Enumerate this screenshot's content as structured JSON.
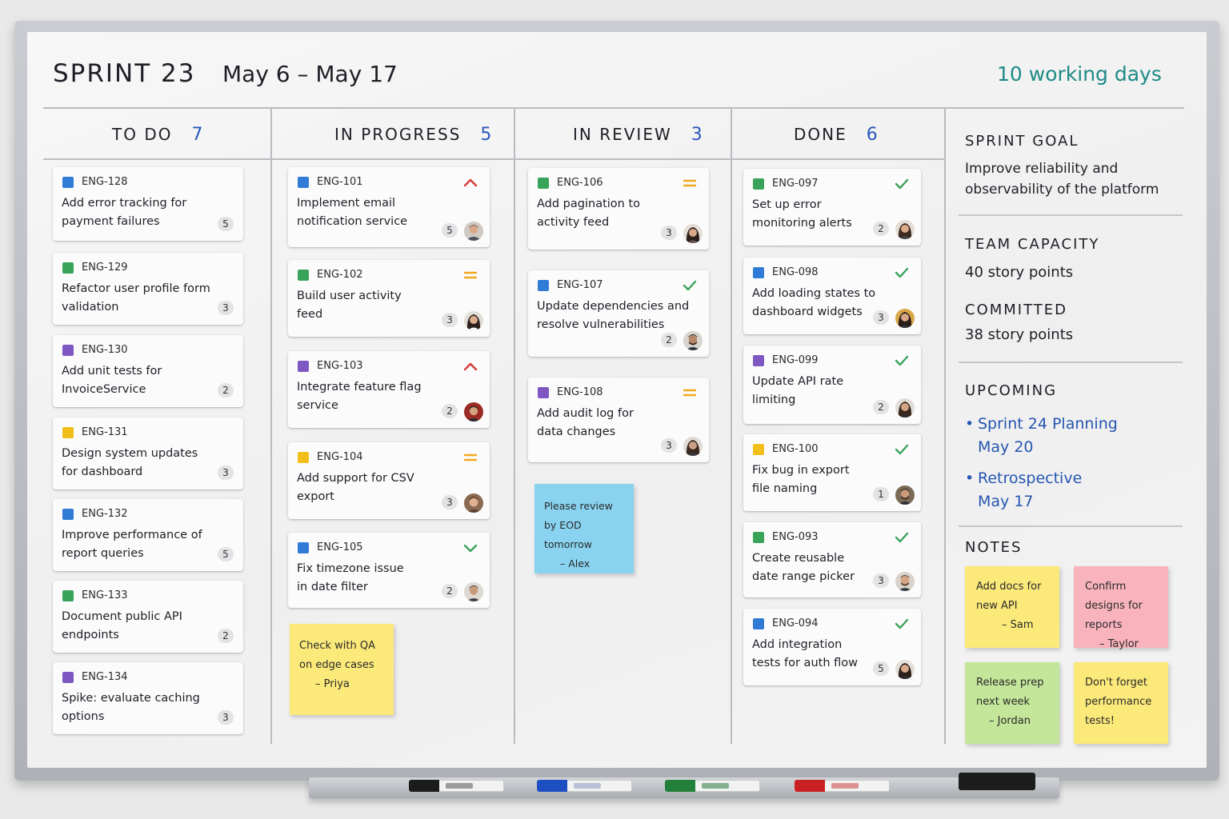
{
  "header": {
    "title": "SPRINT 23",
    "dates": "May 6 – May 17",
    "working_days": "10 working days"
  },
  "columns": [
    {
      "label": "TO DO",
      "count": "7"
    },
    {
      "label": "IN PROGRESS",
      "count": "5"
    },
    {
      "label": "IN REVIEW",
      "count": "3"
    },
    {
      "label": "DONE",
      "count": "6"
    }
  ],
  "todo": [
    {
      "key": "ENG-128",
      "title": "Add error tracking for payment failures",
      "points": "5",
      "color": "#2f7bd6"
    },
    {
      "key": "ENG-129",
      "title": "Refactor user profile form validation",
      "points": "3",
      "color": "#3aa35a"
    },
    {
      "key": "ENG-130",
      "title": "Add unit tests for InvoiceService",
      "points": "2",
      "color": "#7e57c2"
    },
    {
      "key": "ENG-131",
      "title": "Design system updates for dashboard",
      "points": "3",
      "color": "#f2be1a"
    },
    {
      "key": "ENG-132",
      "title": "Improve performance of report queries",
      "points": "5",
      "color": "#2f7bd6"
    },
    {
      "key": "ENG-133",
      "title": "Document public API endpoints",
      "points": "2",
      "color": "#3aa35a"
    },
    {
      "key": "ENG-134",
      "title": "Spike: evaluate caching options",
      "points": "3",
      "color": "#7e57c2"
    }
  ],
  "in_progress": [
    {
      "key": "ENG-101",
      "title": "Implement email notification service",
      "points": "5",
      "color": "#2f7bd6",
      "priority": "high-priority-icon"
    },
    {
      "key": "ENG-102",
      "title": "Build user activity feed",
      "points": "3",
      "color": "#3aa35a",
      "priority": "medium-priority-icon"
    },
    {
      "key": "ENG-103",
      "title": "Integrate feature flag service",
      "points": "2",
      "color": "#7e57c2",
      "priority": "high-priority-icon"
    },
    {
      "key": "ENG-104",
      "title": "Add support for CSV export",
      "points": "3",
      "color": "#f2be1a",
      "priority": "medium-priority-icon"
    },
    {
      "key": "ENG-105",
      "title": "Fix timezone issue in date filter",
      "points": "2",
      "color": "#2f7bd6",
      "priority": "low-priority-icon"
    }
  ],
  "in_review": [
    {
      "key": "ENG-106",
      "title": "Add pagination to activity feed",
      "points": "3",
      "color": "#3aa35a",
      "priority": "medium-priority-icon"
    },
    {
      "key": "ENG-107",
      "title": "Update dependencies and resolve vulnerabilities",
      "points": "2",
      "color": "#2f7bd6",
      "priority": "low-priority-icon"
    },
    {
      "key": "ENG-108",
      "title": "Add audit log for data changes",
      "points": "3",
      "color": "#7e57c2",
      "priority": "medium-priority-icon"
    }
  ],
  "done": [
    {
      "key": "ENG-097",
      "title": "Set up error monitoring alerts",
      "points": "2",
      "color": "#3aa35a"
    },
    {
      "key": "ENG-098",
      "title": "Add loading states to dashboard widgets",
      "points": "3",
      "color": "#2f7bd6"
    },
    {
      "key": "ENG-099",
      "title": "Update API rate limiting",
      "points": "2",
      "color": "#7e57c2"
    },
    {
      "key": "ENG-100",
      "title": "Fix bug in export file naming",
      "points": "1",
      "color": "#f2be1a"
    },
    {
      "key": "ENG-093",
      "title": "Create reusable date range picker",
      "points": "3",
      "color": "#3aa35a"
    },
    {
      "key": "ENG-094",
      "title": "Add integration tests for auth flow",
      "points": "5",
      "color": "#2f7bd6"
    }
  ],
  "stickies": {
    "qa": {
      "text": "Check with QA on edge cases",
      "author": "– Priya"
    },
    "review": {
      "text": "Please review by EOD tomorrow",
      "author": "– Alex"
    }
  },
  "sidebar": {
    "goal_heading": "SPRINT GOAL",
    "goal_text": "Improve reliability and observability of the platform",
    "capacity_heading": "TEAM CAPACITY",
    "capacity_value": "40 story points",
    "committed_heading": "COMMITTED",
    "committed_value": "38 story points",
    "upcoming_heading": "UPCOMING",
    "upcoming": [
      {
        "title": "Sprint 24 Planning",
        "date": "May 20"
      },
      {
        "title": "Retrospective",
        "date": "May 17"
      }
    ],
    "notes_heading": "NOTES",
    "notes": [
      {
        "text": "Add docs for new API",
        "author": "– Sam",
        "color": "#fbe97a"
      },
      {
        "text": "Confirm designs for reports",
        "author": "– Taylor",
        "color": "#f8b3bd"
      },
      {
        "text": "Release prep next week",
        "author": "– Jordan",
        "color": "#c4e69a"
      },
      {
        "text": "Don't forget performance tests!",
        "author": "",
        "color": "#fbe97a"
      }
    ]
  },
  "colors": {
    "ink": "#1d1f26",
    "accent_teal": "#1d8a86",
    "accent_blue": "#2556b0",
    "priority_high": "#d83b3b",
    "priority_medium": "#f2a81d",
    "done_check": "#3aa35a"
  }
}
